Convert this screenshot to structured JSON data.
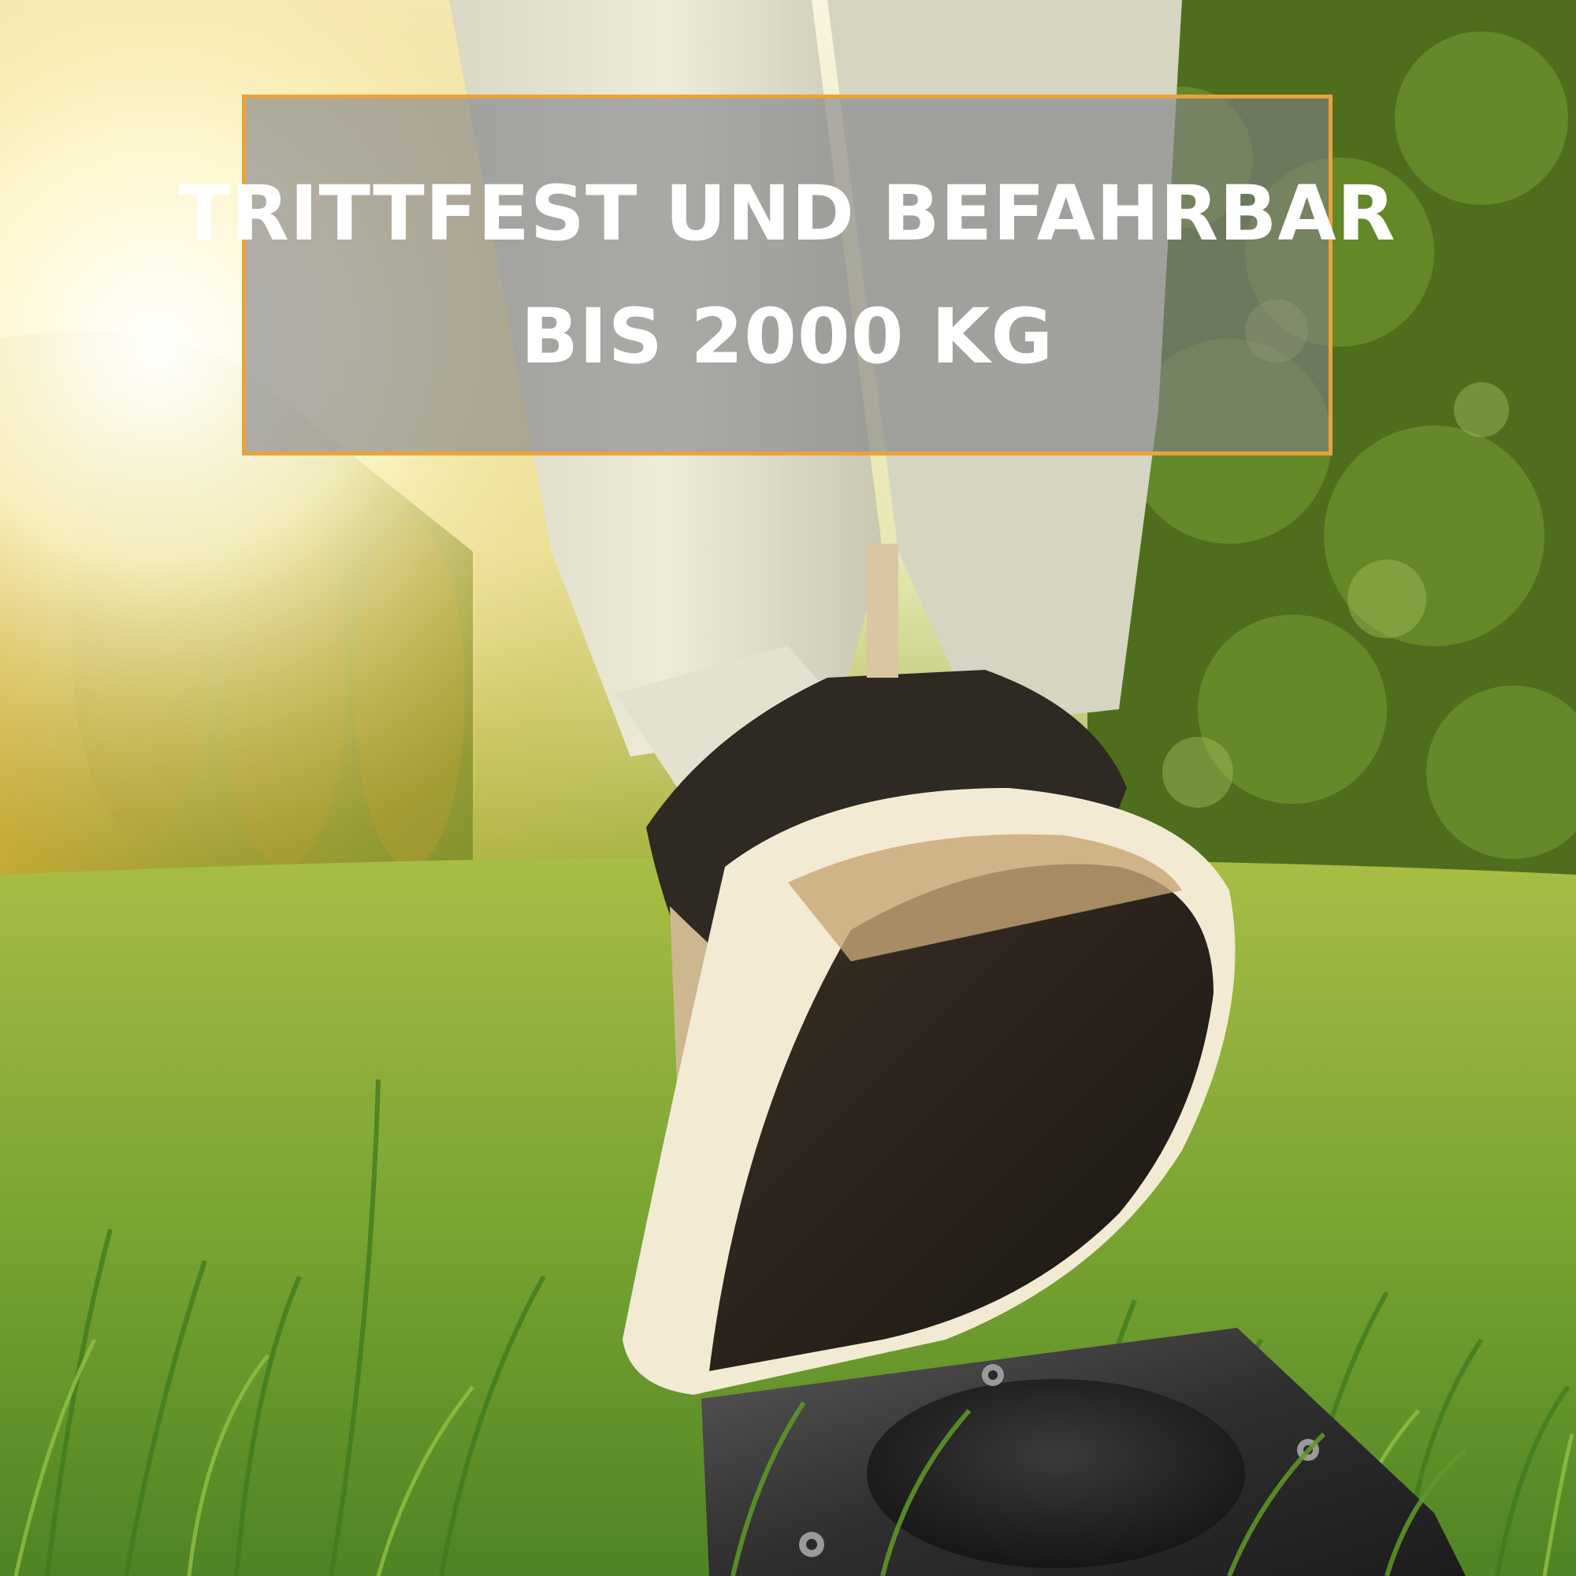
{
  "image": {
    "subject": "sneaker-stepping-on-ground-light",
    "colors": {
      "frame_border": "#e8a33b",
      "panel_fill": "#808086",
      "text": "#ffffff",
      "grass": "#7da33a",
      "sun": "#fff6c8"
    }
  },
  "headline": {
    "line1": "TRITTFEST UND BEFAHRBAR",
    "line2": "BIS 2000 KG"
  }
}
